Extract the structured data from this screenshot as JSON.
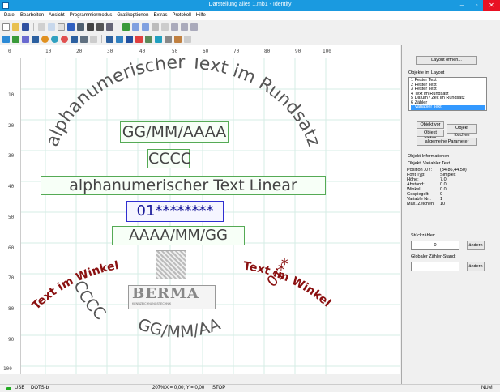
{
  "window": {
    "title": "Darstellung alles 1.mb1 - Identify"
  },
  "menu": [
    "Datei",
    "Bearbeiten",
    "Ansicht",
    "Programmiermodus",
    "Grafikoptionen",
    "Extras",
    "Protokoll",
    "Hilfe"
  ],
  "ruler": {
    "x_labels": [
      "0",
      "10",
      "20",
      "30",
      "40",
      "50",
      "60",
      "70",
      "80",
      "90",
      "100"
    ],
    "y_labels": [
      "10",
      "20",
      "30",
      "40",
      "50",
      "60",
      "70",
      "80",
      "90",
      "100"
    ]
  },
  "canvas": {
    "arc_top": "alphanumerischer Text im Rundsatz",
    "date1": "GG/MM/AAAA",
    "cccc": "CCCC",
    "linear": "alphanumerischer Text Linear",
    "variable": "01********",
    "date2": "AAAA/MM/GG",
    "winkel_left": "Text im Winkel",
    "winkel_right": "Text im Winkel",
    "cccc_arc": "CCCC",
    "n01_arc": "01**",
    "date3": "GG/MM/AA",
    "logo": "BERMA",
    "logo_sub": "KENNZEICHNUNGSTECHNIK"
  },
  "panel": {
    "layout_btn": "Layout öffnen...",
    "objects_label": "Objekte im Layout",
    "objects": [
      "1  Fester Text",
      "2  Fester Text",
      "3  Fester Text",
      "4  Text im Rundsatz",
      "5  Datum / Zeit im Rundsatz",
      "6  Zähler",
      "7  Variabler Text"
    ],
    "selected_index": 6,
    "btn_vor": "Objekt vor",
    "btn_hinten": "Objekt hinten",
    "btn_loeschen": "Objekt löschen",
    "btn_params": "allgemeine Parameter",
    "info_label": "Objekt-Informationen",
    "info_object": "Objekt:  Variabler Text",
    "info_rows": [
      {
        "k": "Position X/Y:",
        "v": "(34.86,44.50)"
      },
      {
        "k": "Font Typ:",
        "v": "Simplex"
      },
      {
        "k": "Höhe:",
        "v": "7.0"
      },
      {
        "k": "Abstand:",
        "v": "0.0"
      },
      {
        "k": "Winkel:",
        "v": "0.0"
      },
      {
        "k": "Gespiegelt:",
        "v": "0"
      },
      {
        "k": "Variable Nr.:",
        "v": "1"
      },
      {
        "k": "Max. Zeichen:",
        "v": "10"
      }
    ],
    "stueck_label": "Stückzähler:",
    "stueck_value": "0",
    "global_label": "Globaler Zähler-Stand:",
    "global_value": "--------",
    "aendern": "ändern"
  },
  "status": {
    "usb": "USB",
    "device": "DOTS-b",
    "zoom": "207%",
    "coords": "X = 0,00; Y = 0,00",
    "state": "STOP",
    "num": "NUM"
  },
  "colors": {
    "title": "#1a9ae0",
    "close": "#e81123",
    "grid": "#cfe8e0",
    "box_border": "#5a5",
    "selected": "#3399ff"
  }
}
